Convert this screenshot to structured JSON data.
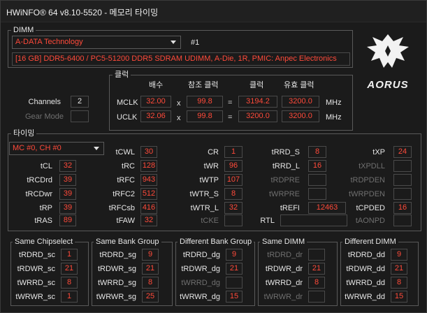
{
  "window": {
    "title": "HWiNFO® 64 v8.10-5520 - 메모리 타이밍"
  },
  "dimm": {
    "group_label": "DIMM",
    "module_select": "A-DATA Technology",
    "slot": "#1",
    "description": "[16 GB] DDR5-6400 / PC5-51200 DDR5 SDRAM UDIMM, A-Die, 1R, PMIC: Anpec Electronics"
  },
  "logo": {
    "text": "AORUS"
  },
  "general": {
    "channels_label": "Channels",
    "channels_value": "2",
    "gear_mode_label": "Gear Mode",
    "gear_mode_value": ""
  },
  "clock": {
    "group_label": "클럭",
    "headers": {
      "multiplier": "배수",
      "ref_clock": "참조 클럭",
      "clock": "클럭",
      "effective_clock": "유효 클럭"
    },
    "rows": [
      {
        "label": "MCLK",
        "multiplier": "32.00",
        "x": "x",
        "ref": "99.8",
        "eq": "=",
        "clock": "3194.2",
        "effective": "3200.0",
        "unit": "MHz"
      },
      {
        "label": "UCLK",
        "multiplier": "32.06",
        "x": "x",
        "ref": "99.8",
        "eq": "=",
        "clock": "3200.0",
        "effective": "3200.0",
        "unit": "MHz"
      }
    ]
  },
  "timings": {
    "group_label": "타이밍",
    "channel_select": "MC #0, CH #0",
    "col1": [
      {
        "label": "tCL",
        "value": "32",
        "active": true
      },
      {
        "label": "tRCDrd",
        "value": "39",
        "active": true
      },
      {
        "label": "tRCDwr",
        "value": "39",
        "active": true
      },
      {
        "label": "tRP",
        "value": "39",
        "active": true
      },
      {
        "label": "tRAS",
        "value": "89",
        "active": true
      }
    ],
    "col2": [
      {
        "label": "tCWL",
        "value": "30",
        "active": true
      },
      {
        "label": "tRC",
        "value": "128",
        "active": true
      },
      {
        "label": "tRFC",
        "value": "943",
        "active": true
      },
      {
        "label": "tRFC2",
        "value": "512",
        "active": true
      },
      {
        "label": "tRFCsb",
        "value": "416",
        "active": true
      },
      {
        "label": "tFAW",
        "value": "32",
        "active": true
      }
    ],
    "col3": [
      {
        "label": "CR",
        "value": "1",
        "active": true
      },
      {
        "label": "tWR",
        "value": "96",
        "active": true
      },
      {
        "label": "tWTP",
        "value": "107",
        "active": true
      },
      {
        "label": "tWTR_S",
        "value": "8",
        "active": true
      },
      {
        "label": "tWTR_L",
        "value": "32",
        "active": true
      },
      {
        "label": "tCKE",
        "value": "",
        "active": false
      }
    ],
    "col4": [
      {
        "label": "tRRD_S",
        "value": "8",
        "active": true
      },
      {
        "label": "tRRD_L",
        "value": "16",
        "active": true
      },
      {
        "label": "tRDPRE",
        "value": "",
        "active": false
      },
      {
        "label": "tWRPRE",
        "value": "",
        "active": false
      },
      {
        "label": "tREFI",
        "value": "12463",
        "active": true
      },
      {
        "label": "RTL",
        "value": "",
        "active": true
      }
    ],
    "col5": [
      {
        "label": "tXP",
        "value": "24",
        "active": true
      },
      {
        "label": "tXPDLL",
        "value": "",
        "active": false
      },
      {
        "label": "tRDPDEN",
        "value": "",
        "active": false
      },
      {
        "label": "tWRPDEN",
        "value": "",
        "active": false
      },
      {
        "label": "tCPDED",
        "value": "16",
        "active": true
      },
      {
        "label": "tAONPD",
        "value": "",
        "active": false
      }
    ]
  },
  "turnaround": [
    {
      "title": "Same Chipselect",
      "rows": [
        {
          "label": "tRDRD_sc",
          "value": "1",
          "active": true
        },
        {
          "label": "tRDWR_sc",
          "value": "21",
          "active": true
        },
        {
          "label": "tWRRD_sc",
          "value": "8",
          "active": true
        },
        {
          "label": "tWRWR_sc",
          "value": "1",
          "active": true
        }
      ]
    },
    {
      "title": "Same Bank Group",
      "rows": [
        {
          "label": "tRDRD_sg",
          "value": "9",
          "active": true
        },
        {
          "label": "tRDWR_sg",
          "value": "21",
          "active": true
        },
        {
          "label": "tWRRD_sg",
          "value": "8",
          "active": true
        },
        {
          "label": "tWRWR_sg",
          "value": "25",
          "active": true
        }
      ]
    },
    {
      "title": "Different Bank Group",
      "rows": [
        {
          "label": "tRDRD_dg",
          "value": "9",
          "active": true
        },
        {
          "label": "tRDWR_dg",
          "value": "21",
          "active": true
        },
        {
          "label": "tWRRD_dg",
          "value": "",
          "active": false
        },
        {
          "label": "tWRWR_dg",
          "value": "15",
          "active": true
        }
      ]
    },
    {
      "title": "Same DIMM",
      "rows": [
        {
          "label": "tRDRD_dr",
          "value": "",
          "active": false
        },
        {
          "label": "tRDWR_dr",
          "value": "21",
          "active": true
        },
        {
          "label": "tWRRD_dr",
          "value": "8",
          "active": true
        },
        {
          "label": "tWRWR_dr",
          "value": "",
          "active": false
        }
      ]
    },
    {
      "title": "Different DIMM",
      "rows": [
        {
          "label": "tRDRD_dd",
          "value": "9",
          "active": true
        },
        {
          "label": "tRDWR_dd",
          "value": "21",
          "active": true
        },
        {
          "label": "tWRRD_dd",
          "value": "8",
          "active": true
        },
        {
          "label": "tWRWR_dd",
          "value": "15",
          "active": true
        }
      ]
    }
  ],
  "colors": {
    "value": "#ff4a3a",
    "border": "#5a5a5a",
    "background": "#1b1b1b",
    "dim": "#6f6f6f"
  }
}
